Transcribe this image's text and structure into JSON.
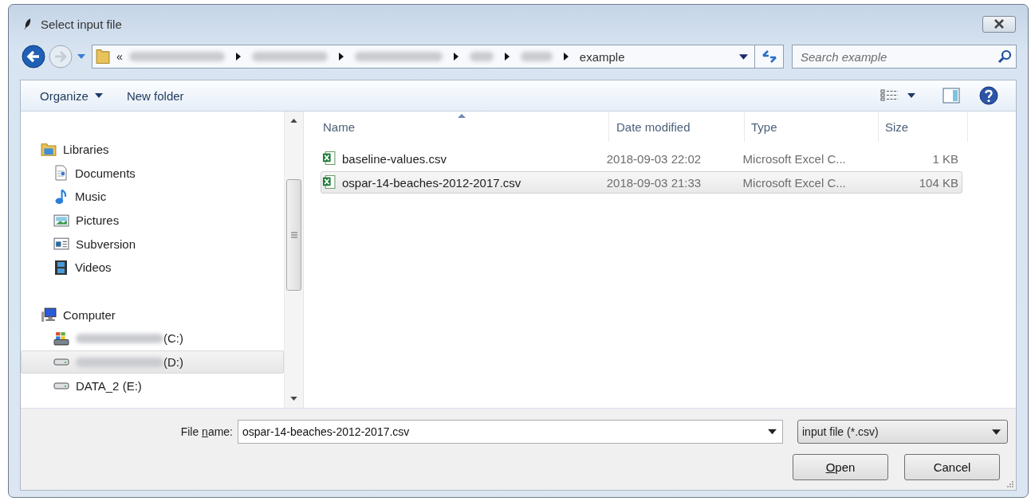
{
  "window": {
    "title": "Select input file"
  },
  "address": {
    "overflow": "«",
    "segments": [
      {
        "kind": "blurred"
      },
      {
        "kind": "blurred"
      },
      {
        "kind": "blurred"
      },
      {
        "kind": "blurred"
      },
      {
        "kind": "blurred"
      },
      {
        "kind": "text",
        "text": "example"
      }
    ]
  },
  "search": {
    "placeholder": "Search example"
  },
  "toolbar": {
    "organize": "Organize",
    "new_folder": "New folder"
  },
  "nav": [
    {
      "label": "Libraries",
      "selected": false,
      "children": [
        {
          "label": "Documents",
          "selected": false
        },
        {
          "label": "Music",
          "selected": false
        },
        {
          "label": "Pictures",
          "selected": false
        },
        {
          "label": "Subversion",
          "selected": false
        },
        {
          "label": "Videos",
          "selected": false
        }
      ]
    },
    {
      "label": "Computer",
      "selected": false,
      "children": [
        {
          "label": "(C:)",
          "blurred_name": true,
          "selected": false
        },
        {
          "label": "(D:)",
          "blurred_name": true,
          "selected": true
        },
        {
          "label": "DATA_2 (E:)",
          "blurred_name": false,
          "selected": false
        }
      ]
    }
  ],
  "table": {
    "columns": [
      "Name",
      "Date modified",
      "Type",
      "Size"
    ],
    "rows": [
      {
        "name": "baseline-values.csv",
        "date": "2018-09-03 22:02",
        "type": "Microsoft Excel C...",
        "size": "1 KB",
        "selected": false
      },
      {
        "name": "ospar-14-beaches-2012-2017.csv",
        "date": "2018-09-03 21:33",
        "type": "Microsoft Excel C...",
        "size": "104 KB",
        "selected": true
      }
    ]
  },
  "file_name": {
    "label_parts": [
      {
        "text": "File ",
        "underlined": false
      },
      {
        "text": "n",
        "underlined": true
      },
      {
        "text": "ame:",
        "underlined": false
      }
    ],
    "value": "ospar-14-beaches-2012-2017.csv"
  },
  "filter": {
    "value": "input file (*.csv)"
  },
  "buttons": [
    {
      "label_parts": [
        {
          "text": "O",
          "underlined": true
        },
        {
          "text": "pen",
          "underlined": false
        }
      ]
    },
    {
      "label_parts": [
        {
          "text": "Cancel",
          "underlined": false
        }
      ]
    }
  ]
}
